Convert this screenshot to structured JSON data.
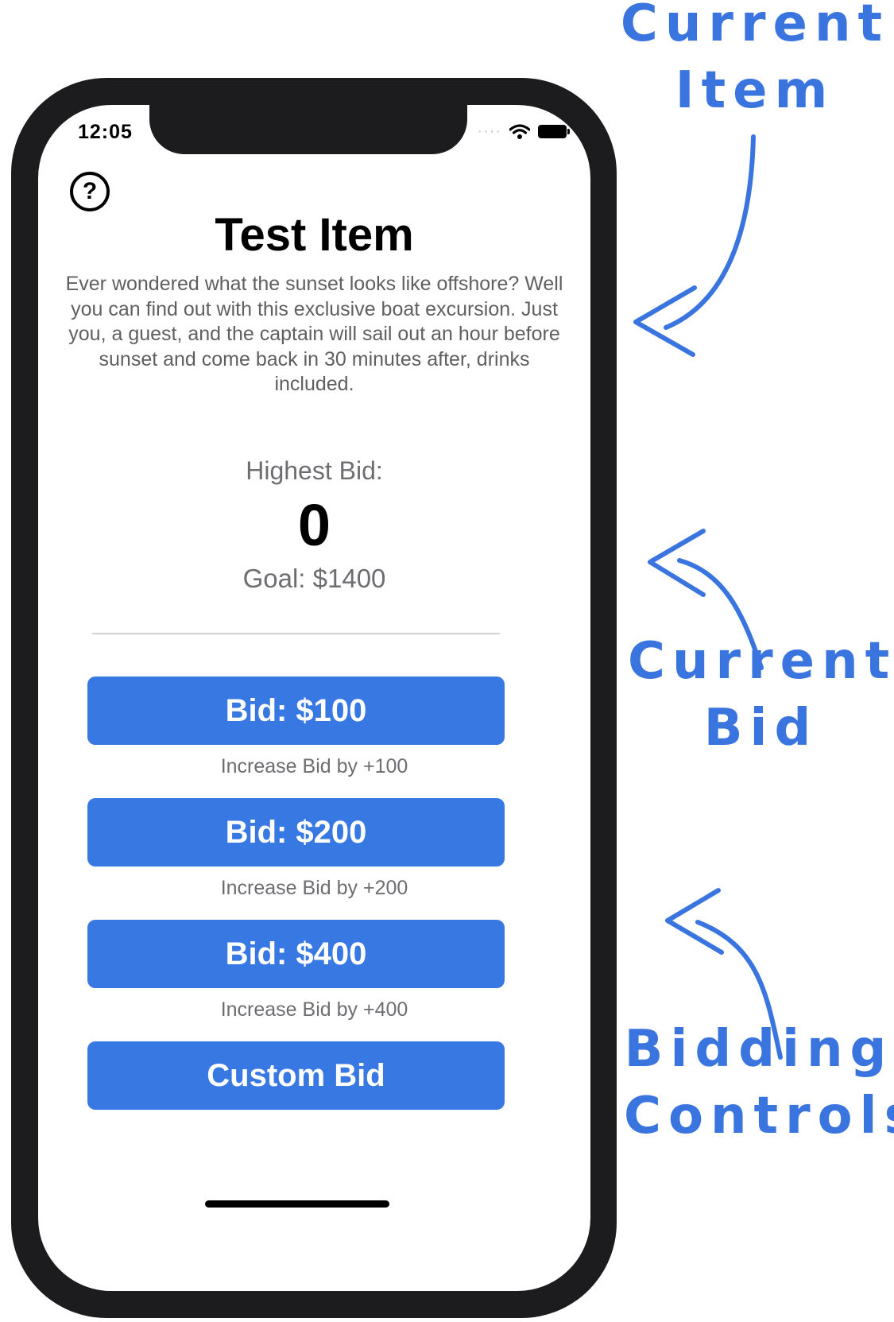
{
  "status_bar": {
    "time": "12:05",
    "icons": [
      "signal-icon",
      "wifi-icon",
      "battery-icon"
    ]
  },
  "help": {
    "icon": "question-circle-icon",
    "glyph": "?"
  },
  "item": {
    "title": "Test Item",
    "description": "Ever wondered what the sunset looks like offshore?  Well you can find out with this exclusive boat excursion.  Just you, a guest, and the captain will sail out an hour before sunset and come back in 30 minutes after, drinks included."
  },
  "bid_status": {
    "highest_label": "Highest Bid:",
    "highest_value": "0",
    "goal_label": "Goal: $1400"
  },
  "controls": {
    "bid_100_label": "Bid: $100",
    "bid_100_caption": "Increase Bid by +100",
    "bid_200_label": "Bid: $200",
    "bid_200_caption": "Increase Bid by +200",
    "bid_400_label": "Bid: $400",
    "bid_400_caption": "Increase Bid by +400",
    "custom_label": "Custom Bid"
  },
  "annotations": {
    "current_item": "Current Item",
    "current_item_line1": "Current",
    "current_item_line2": "Item",
    "current_bid_line1": "Current",
    "current_bid_line2": "Bid",
    "bidding_controls_line1": "Bidding",
    "bidding_controls_line2": "Controls"
  },
  "colors": {
    "accent": "#3778e3",
    "annotation": "#3a75df",
    "frame": "#1c1c1e",
    "secondary_text": "#6d6d72"
  }
}
